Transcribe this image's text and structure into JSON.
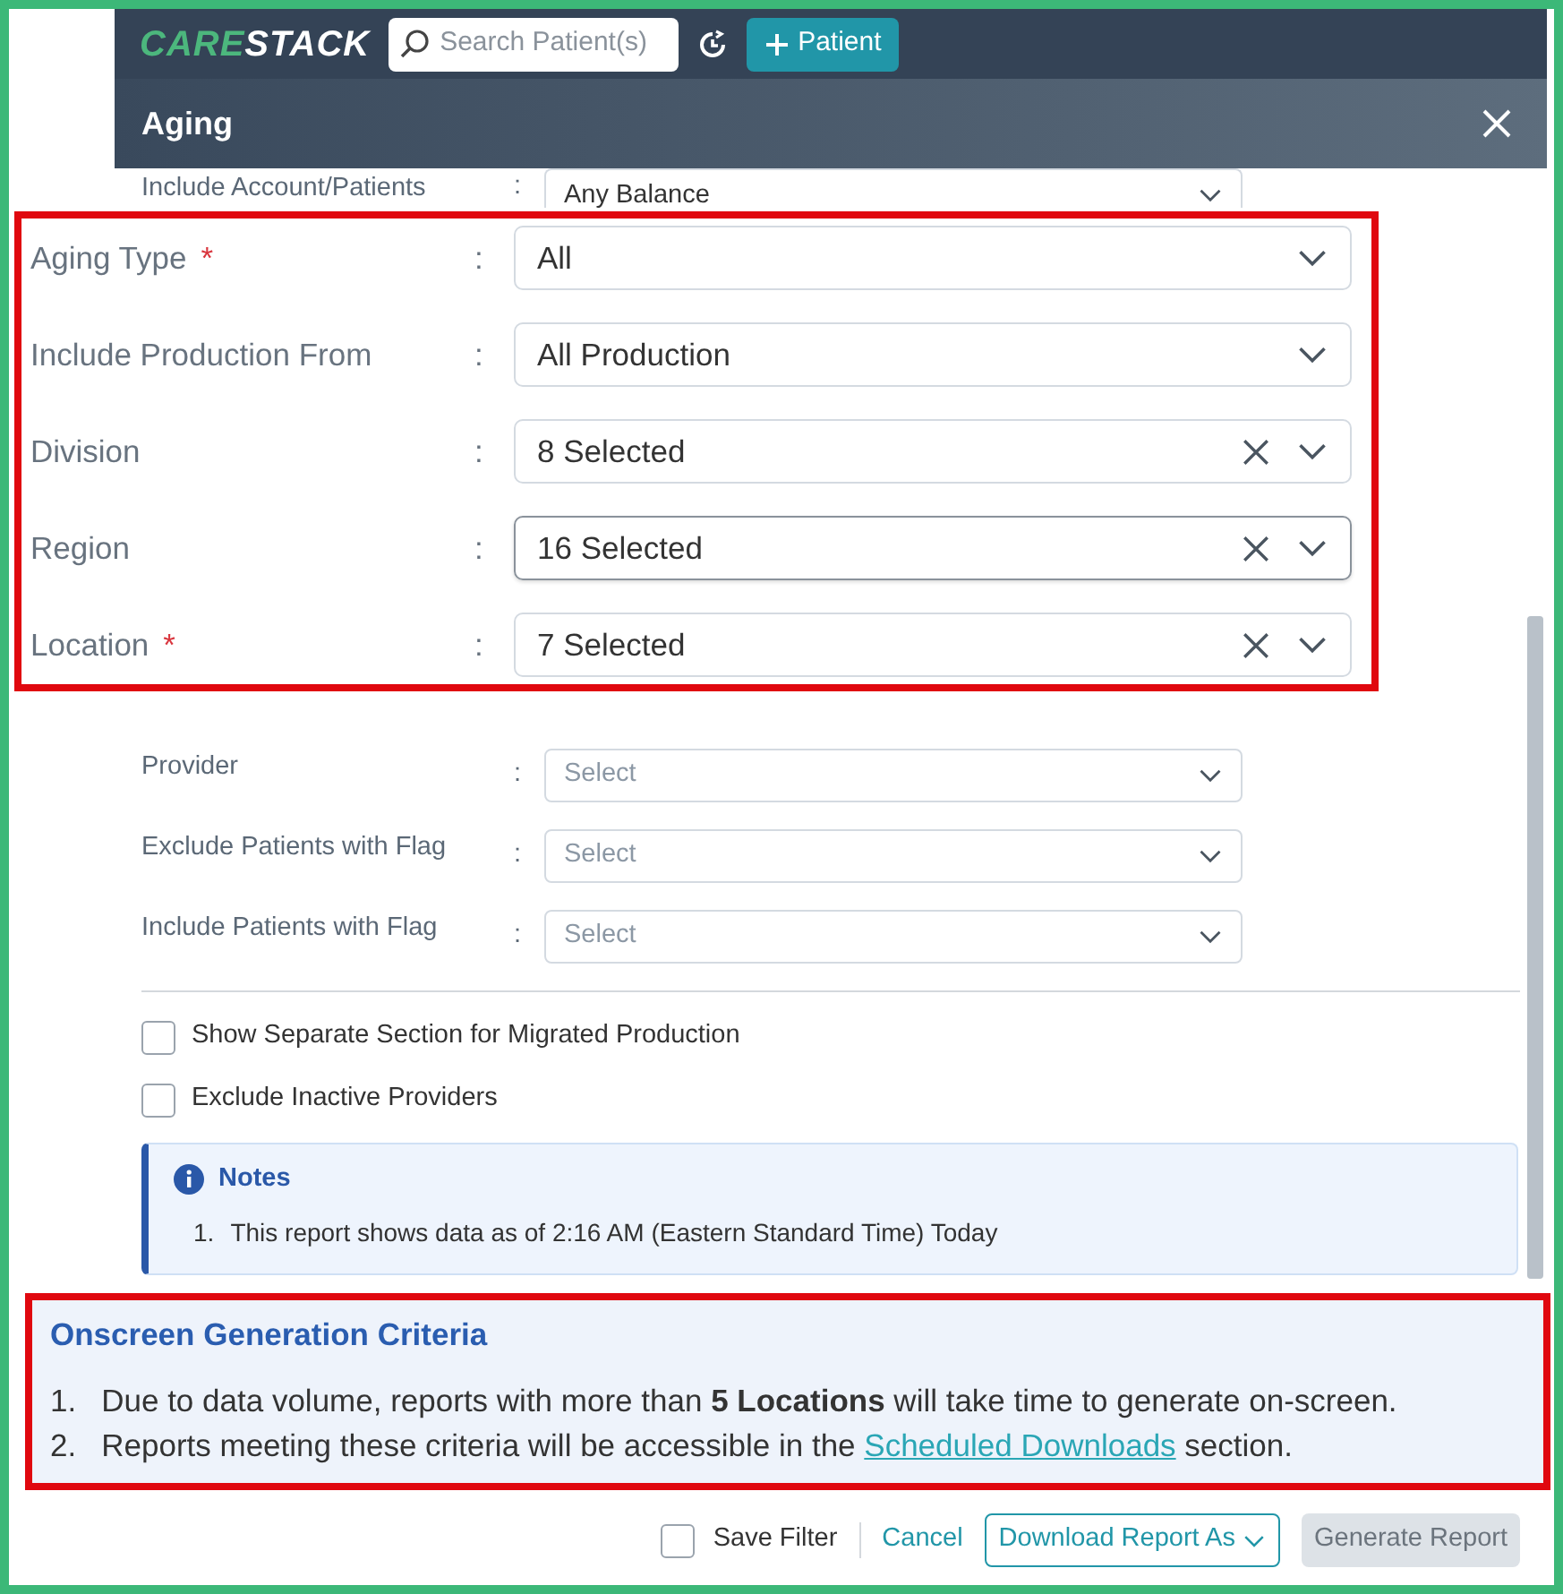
{
  "app_bar": {
    "logo": {
      "part_1": "CARE",
      "part_2": "STACK"
    },
    "search": {
      "placeholder": "Search Patient(s)"
    },
    "add_button": "Patient"
  },
  "dialog": {
    "title": "Aging",
    "top_filter": {
      "label": "Include Account/Patients",
      "separator": ":",
      "value": "Any Balance"
    },
    "filters": [
      {
        "label": "Provider",
        "separator": ":",
        "placeholder": "Select"
      },
      {
        "label": "Exclude Patients with Flag",
        "separator": ":",
        "placeholder": "Select"
      },
      {
        "label": "Include Patients with Flag",
        "separator": ":",
        "placeholder": "Select"
      }
    ],
    "options": [
      {
        "label": "Show Separate Section for Migrated Production",
        "checked": false
      },
      {
        "label": "Exclude Inactive Providers",
        "checked": false
      }
    ],
    "notes": {
      "title": "Notes",
      "items": [
        {
          "number": "1.",
          "text": "This report shows data as of 2:16 AM (Eastern Standard Time) Today"
        }
      ]
    },
    "footer": {
      "save_filter": {
        "label": "Save Filter",
        "checked": false
      },
      "cancel": "Cancel",
      "download": "Download Report As",
      "generate": {
        "label": "Generate Report",
        "disabled": true
      }
    }
  },
  "zoomed_filters": [
    {
      "label": "Aging Type",
      "required_mark": "*",
      "separator": ":",
      "value": "All",
      "clearable": false,
      "focused": false
    },
    {
      "label": "Include Production From",
      "separator": ":",
      "value": "All Production",
      "clearable": false,
      "focused": false
    },
    {
      "label": "Division",
      "separator": ":",
      "value": "8 Selected",
      "clearable": true,
      "focused": false
    },
    {
      "label": "Region",
      "separator": ":",
      "value": "16 Selected",
      "clearable": true,
      "focused": true
    },
    {
      "label": "Location",
      "required_mark": "*",
      "separator": ":",
      "value": "7 Selected",
      "clearable": true,
      "focused": false
    }
  ],
  "criteria": {
    "title": "Onscreen Generation Criteria",
    "items": [
      {
        "number": "1.",
        "text": "Due to data volume, reports with more than **5 Locations** will take time to generate on-screen."
      },
      {
        "number": "2.",
        "text": "Reports meeting these criteria will be accessible in the",
        "link": "Scheduled Downloads",
        "text_after": "section."
      }
    ]
  }
}
